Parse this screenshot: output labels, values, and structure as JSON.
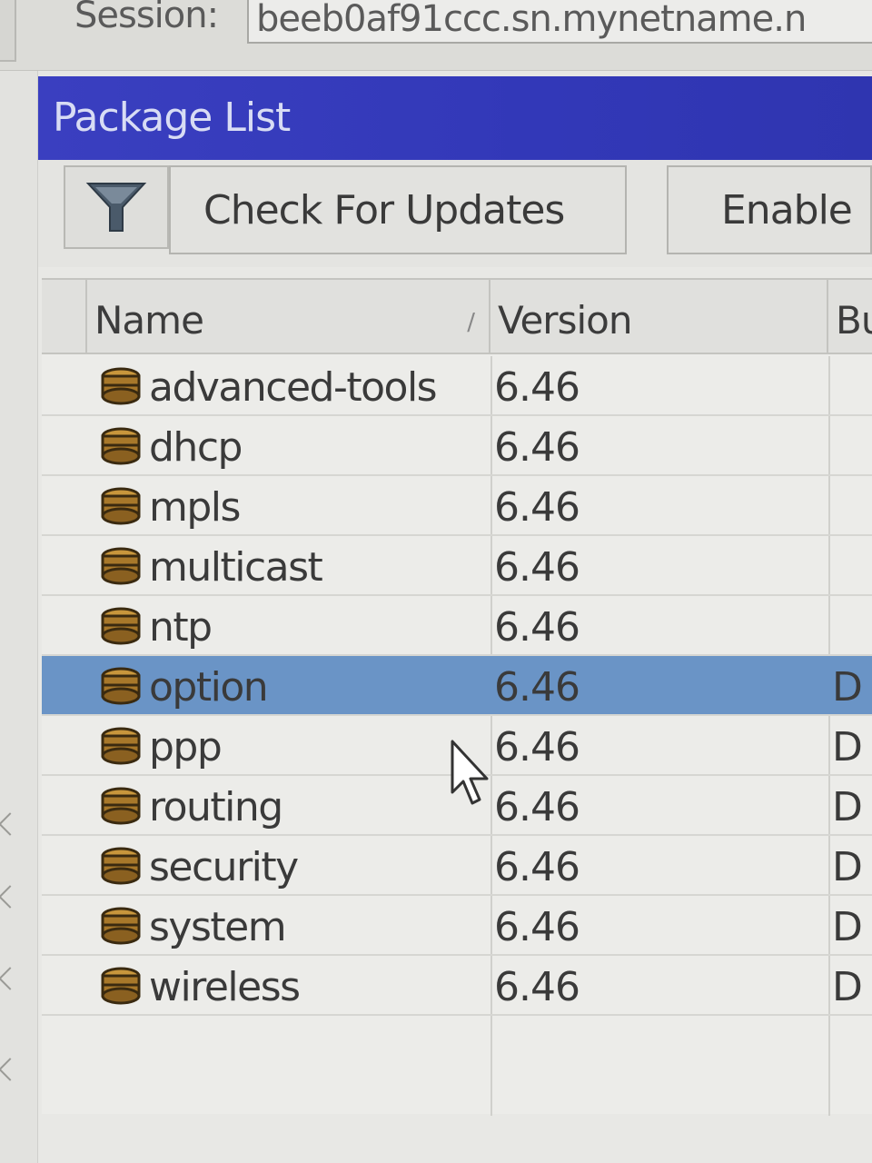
{
  "session": {
    "label": "Session:",
    "value": "beeb0af91ccc.sn.mynetname.n"
  },
  "window": {
    "title": "Package List"
  },
  "toolbar": {
    "filter_icon": "filter-icon",
    "check_updates_label": "Check For Updates",
    "enable_label": "Enable"
  },
  "table": {
    "columns": [
      {
        "label": "Name",
        "sort": "ascending"
      },
      {
        "label": "Version"
      },
      {
        "label": "Bu"
      }
    ],
    "rows": [
      {
        "name": "advanced-tools",
        "version": "6.46",
        "build": "",
        "selected": false
      },
      {
        "name": "dhcp",
        "version": "6.46",
        "build": "",
        "selected": false
      },
      {
        "name": "mpls",
        "version": "6.46",
        "build": "",
        "selected": false
      },
      {
        "name": "multicast",
        "version": "6.46",
        "build": "",
        "selected": false
      },
      {
        "name": "ntp",
        "version": "6.46",
        "build": "",
        "selected": false
      },
      {
        "name": "option",
        "version": "6.46",
        "build": "D",
        "selected": true
      },
      {
        "name": "ppp",
        "version": "6.46",
        "build": "D",
        "selected": false
      },
      {
        "name": "routing",
        "version": "6.46",
        "build": "D",
        "selected": false
      },
      {
        "name": "security",
        "version": "6.46",
        "build": "D",
        "selected": false
      },
      {
        "name": "system",
        "version": "6.46",
        "build": "D",
        "selected": false
      },
      {
        "name": "wireless",
        "version": "6.46",
        "build": "D",
        "selected": false
      }
    ],
    "row_icon": "package-icon"
  },
  "colors": {
    "titlebar": "#3238b8",
    "selected_row": "#6a94c6",
    "package_icon": "#a8782a"
  }
}
